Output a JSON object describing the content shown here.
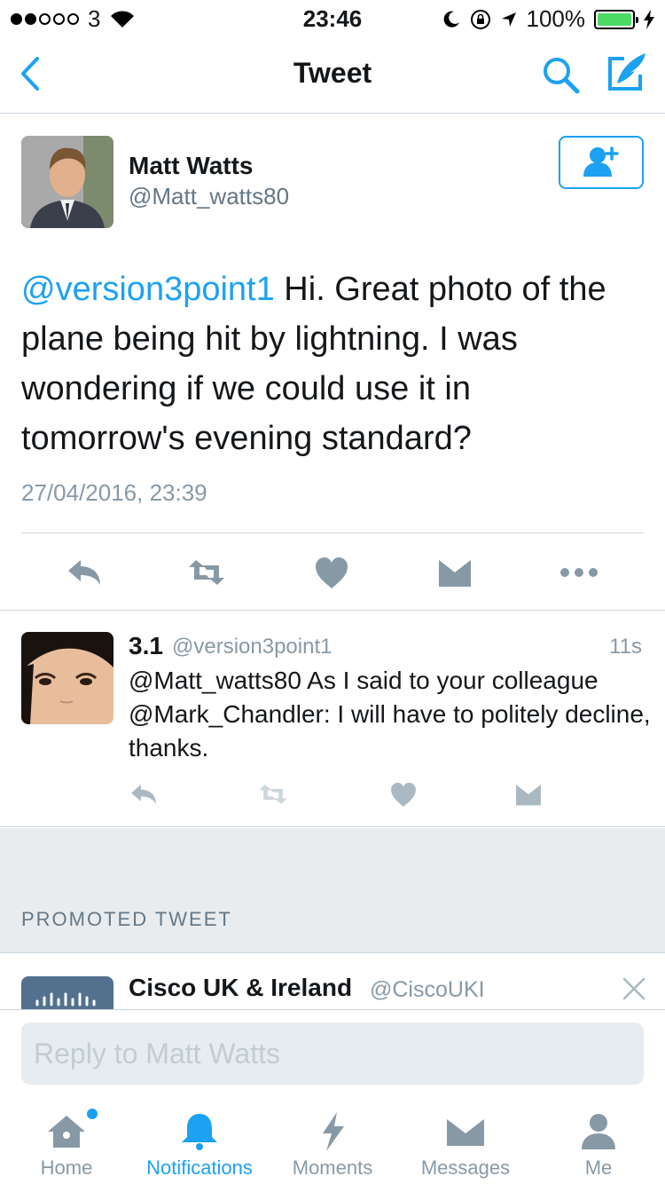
{
  "status_bar": {
    "carrier": "3",
    "time": "23:46",
    "battery": "100%",
    "battery_level": 1.0
  },
  "nav": {
    "title": "Tweet",
    "back_icon": "chevron-left-icon",
    "search_icon": "search-icon",
    "compose_icon": "compose-icon"
  },
  "main_tweet": {
    "author_name": "Matt Watts",
    "author_handle": "@Matt_watts80",
    "mention": "@version3point1",
    "text": " Hi. Great photo of the plane being hit by lightning. I was wondering if we could use it in tomorrow's evening standard?",
    "timestamp": "27/04/2016, 23:39",
    "follow_icon": "follow-user-icon"
  },
  "reply_tweet": {
    "author_name": "3.1",
    "author_handle": "@version3point1",
    "time_ago": "11s",
    "text": "@Matt_watts80 As I said to your colleague @Mark_Chandler: I will have to politely decline, thanks."
  },
  "promoted": {
    "label": "PROMOTED TWEET",
    "author_name": "Cisco UK & Ireland",
    "author_handle": "@CiscoUKI"
  },
  "reply_box": {
    "placeholder": "Reply to Matt Watts"
  },
  "tabs": [
    {
      "label": "Home",
      "icon": "home-icon"
    },
    {
      "label": "Notifications",
      "icon": "bell-icon"
    },
    {
      "label": "Moments",
      "icon": "lightning-icon"
    },
    {
      "label": "Messages",
      "icon": "envelope-icon"
    },
    {
      "label": "Me",
      "icon": "person-icon"
    }
  ],
  "colors": {
    "accent": "#1da1f2",
    "icon_gray": "#8899a6",
    "divider": "#ccd6dd",
    "section_gray": "#e8ecef",
    "battery_green": "#4cd964"
  }
}
